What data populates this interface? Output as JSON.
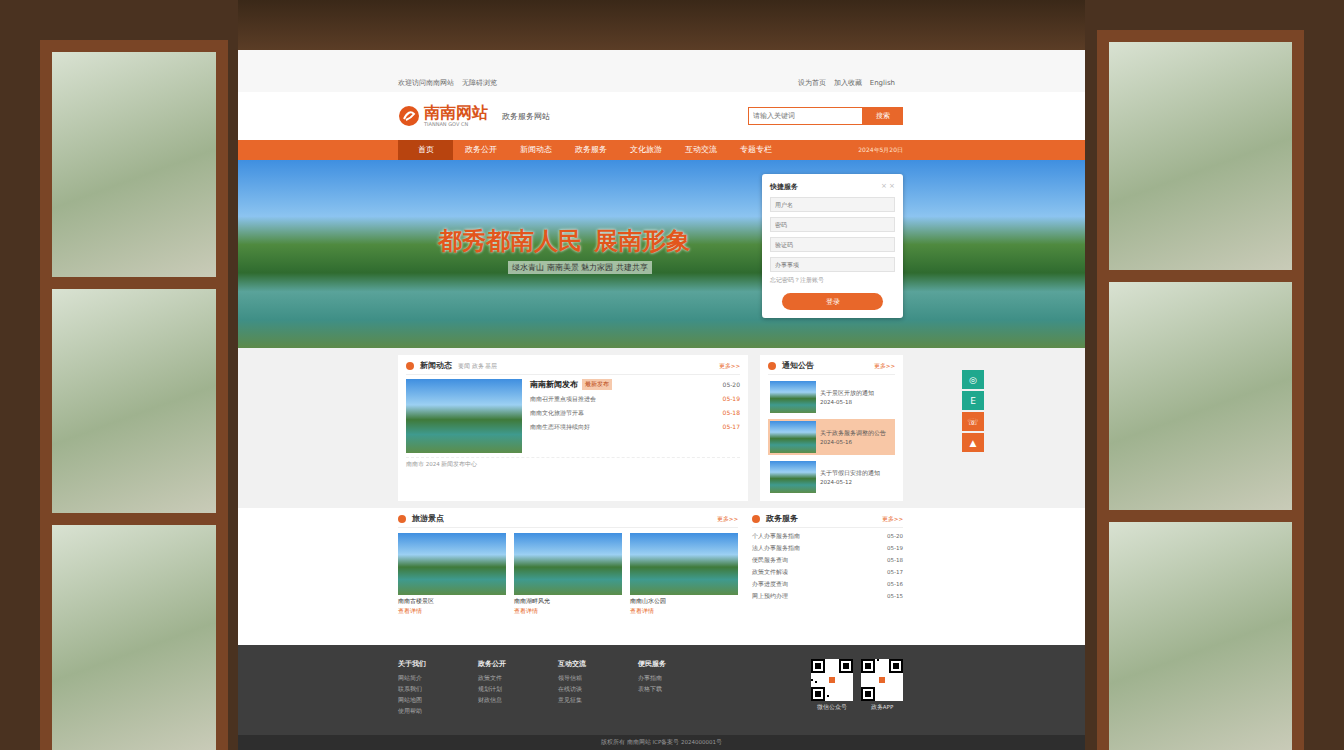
{
  "topbar": {
    "left": [
      "欢迎访问南南网站",
      "无障碍浏览"
    ],
    "right": [
      "设为首页",
      "加入收藏",
      "English"
    ]
  },
  "header": {
    "logo_title": "南南网站",
    "logo_subtitle": "TIANNAN GOV CN",
    "slogan": "政务服务网站"
  },
  "search": {
    "placeholder": "请输入关键词",
    "button": "搜索"
  },
  "nav": {
    "items": [
      {
        "label": "首页",
        "selected": true
      },
      {
        "label": "政务公开",
        "selected": false
      },
      {
        "label": "新闻动态",
        "selected": false
      },
      {
        "label": "政务服务",
        "selected": false
      },
      {
        "label": "文化旅游",
        "selected": false
      },
      {
        "label": "互动交流",
        "selected": false
      },
      {
        "label": "专题专栏",
        "selected": false
      }
    ],
    "date": "2024年5月20日"
  },
  "banner": {
    "title_left": "都秀都南人民",
    "title_right": "展南形象",
    "subtitle": "绿水青山 南南美景 魅力家园 共建共享"
  },
  "login": {
    "title": "快捷服务",
    "close": "× ×",
    "fields": [
      "用户名",
      "密码",
      "验证码",
      "办事事项"
    ],
    "hint": "忘记密码？注册账号",
    "button": "登录"
  },
  "news": {
    "title": "新闻动态",
    "tabs": "要闻 政务 基层",
    "more": "更多>>",
    "headline": "南南新闻发布",
    "tag": "最新发布",
    "date": "05-20",
    "items": [
      {
        "text": "南南召开重点项目推进会",
        "date": "05-19"
      },
      {
        "text": "南南文化旅游节开幕",
        "date": "05-18"
      },
      {
        "text": "南南生态环境持续向好",
        "date": "05-17"
      }
    ],
    "footer": "南南市 2024 新闻发布中心"
  },
  "notices": {
    "title": "通知公告",
    "more": "更多>>",
    "items": [
      {
        "title": "关于景区开放的通知",
        "sub": "2024-05-18",
        "selected": false
      },
      {
        "title": "关于政务服务调整的公告",
        "sub": "2024-05-16",
        "selected": true
      },
      {
        "title": "关于节假日安排的通知",
        "sub": "2024-05-12",
        "selected": false
      }
    ]
  },
  "side": {
    "items": [
      {
        "glyph": "◎",
        "color": "#1fa88e"
      },
      {
        "glyph": "E",
        "color": "#1fa88e"
      },
      {
        "glyph": "☏",
        "color": "#e8672a"
      },
      {
        "glyph": "▲",
        "color": "#e8672a"
      }
    ]
  },
  "scenic": {
    "title": "旅游景点",
    "more": "更多>>",
    "items": [
      {
        "caption": "南南古楼景区",
        "sub": "查看详情"
      },
      {
        "caption": "南南湖畔风光",
        "sub": "查看详情"
      },
      {
        "caption": "南南山水公园",
        "sub": "查看详情"
      }
    ]
  },
  "services": {
    "title": "政务服务",
    "more": "更多>>",
    "items": [
      {
        "text": "个人办事服务指南",
        "date": "05-20"
      },
      {
        "text": "法人办事服务指南",
        "date": "05-19"
      },
      {
        "text": "便民服务查询",
        "date": "05-18"
      },
      {
        "text": "政策文件解读",
        "date": "05-17"
      },
      {
        "text": "办事进度查询",
        "date": "05-16"
      },
      {
        "text": "网上预约办理",
        "date": "05-15"
      }
    ]
  },
  "footer": {
    "columns": [
      {
        "title": "关于我们",
        "items": [
          "网站简介",
          "联系我们",
          "网站地图",
          "使用帮助"
        ]
      },
      {
        "title": "政务公开",
        "items": [
          "政策文件",
          "规划计划",
          "财政信息"
        ]
      },
      {
        "title": "互动交流",
        "items": [
          "领导信箱",
          "在线访谈",
          "意见征集"
        ]
      },
      {
        "title": "便民服务",
        "items": [
          "办事指南",
          "表格下载"
        ]
      }
    ],
    "qr": [
      {
        "label": "微信公众号"
      },
      {
        "label": "政务APP"
      }
    ]
  },
  "copyright": "版权所有 南南网站 ICP备案号 2024000001号"
}
